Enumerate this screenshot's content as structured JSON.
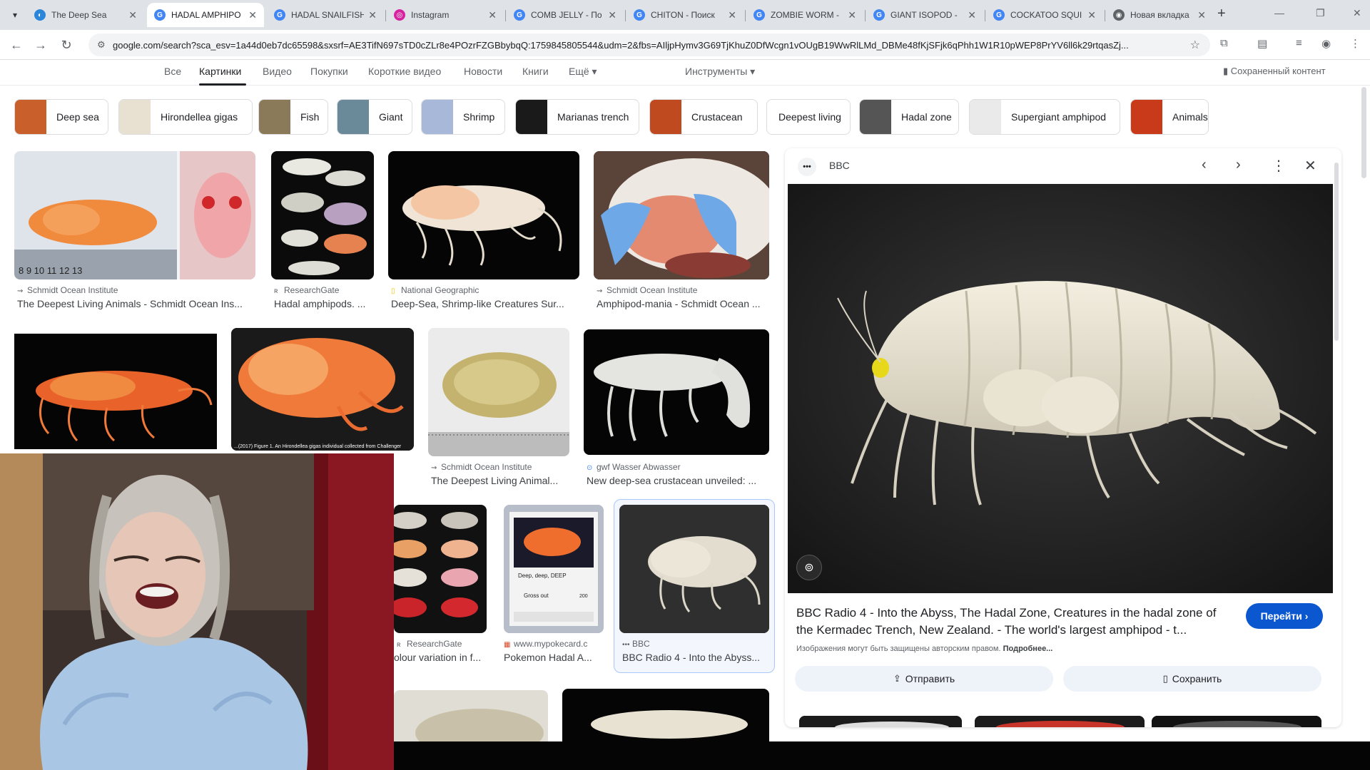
{
  "tabs": [
    {
      "title": "The Deep Sea",
      "icon": "deep-sea-site-icon",
      "color": "#2b86d9"
    },
    {
      "title": "HADAL AMPHIPO",
      "icon": "google-icon",
      "color": "#4285f4",
      "active": true
    },
    {
      "title": "HADAL SNAILFISH",
      "icon": "google-icon",
      "color": "#4285f4"
    },
    {
      "title": "Instagram",
      "icon": "instagram-icon",
      "color": "#d6249f"
    },
    {
      "title": "COMB JELLY - По",
      "icon": "google-icon",
      "color": "#4285f4"
    },
    {
      "title": "CHITON - Поиск",
      "icon": "google-icon",
      "color": "#4285f4"
    },
    {
      "title": "ZOMBIE WORM -",
      "icon": "google-icon",
      "color": "#4285f4"
    },
    {
      "title": "GIANT ISOPOD - ",
      "icon": "google-icon",
      "color": "#4285f4"
    },
    {
      "title": "COCKATOO SQUI",
      "icon": "google-icon",
      "color": "#4285f4"
    },
    {
      "title": "Новая вкладка",
      "icon": "chrome-icon",
      "color": "#5f6368"
    }
  ],
  "address": {
    "url": "google.com/search?sca_esv=1a44d0eb7dc65598&sxsrf=AE3TifN697sTD0cZLr8e4POzrFZGBbybqQ:1759845805544&udm=2&fbs=AIljpHymv3G69TjKhuZ0DfWcgn1vOUgB19WwRlLMd_DBMe48fKjSFjk6qPhh1W1R10pWEP8PrYV6ll6k29rtqasZj..."
  },
  "search_nav": {
    "items": [
      "Все",
      "Картинки",
      "Видео",
      "Покупки",
      "Короткие видео",
      "Новости",
      "Книги",
      "Ещё ▾"
    ],
    "tools": "Инструменты ▾",
    "saved": "Сохраненный контент"
  },
  "chips": [
    "Deep sea",
    "Hirondellea gigas",
    "Fish",
    "Giant",
    "Shrimp",
    "Marianas trench",
    "Crustacean",
    "Deepest living",
    "Hadal zone",
    "Supergiant amphipod",
    "Animals"
  ],
  "results": [
    {
      "source": "Schmidt Ocean Institute",
      "title": "The Deepest Living Animals - Schmidt Ocean Ins..."
    },
    {
      "source": "ResearchGate",
      "title": "Hadal amphipods. ..."
    },
    {
      "source": "National Geographic",
      "title": "Deep-Sea, Shrimp-like Creatures Sur..."
    },
    {
      "source": "Schmidt Ocean Institute",
      "title": "Amphipod-mania - Schmidt Ocean ..."
    },
    {
      "source": "Schmidt Ocean Institute",
      "title": "The Deepest Living Animal..."
    },
    {
      "source": "gwf Wasser Abwasser",
      "title": "New deep-sea crustacean unveiled: ..."
    },
    {
      "source": "ResearchGate",
      "title": "olour variation in f..."
    },
    {
      "source": "www.mypokecard.c",
      "title": "Pokemon Hadal A..."
    },
    {
      "source": "BBC",
      "title": "BBC Radio 4 - Into the Abyss..."
    }
  ],
  "panel": {
    "source": "BBC",
    "logo_text": "•••",
    "title": "BBC Radio 4 - Into the Abyss, The Hadal Zone, Creatures in the hadal zone of the Kermadec Trench, New Zealand. - The world's largest amphipod - t...",
    "visit": "Перейти ›",
    "copyright": "Изображения могут быть защищены авторским правом.",
    "more": "Подробнее...",
    "share": "Отправить",
    "save": "Сохранить"
  },
  "image_texts": {
    "ruler": "8  9  10  11  12  13",
    "card_name": "Deep, deep, DEEP",
    "card_attack": "Gross out",
    "card_damage": "200",
    "caption": "...(2017) Figure 1. An Hirondellea gigas individual collected from Challenger"
  }
}
